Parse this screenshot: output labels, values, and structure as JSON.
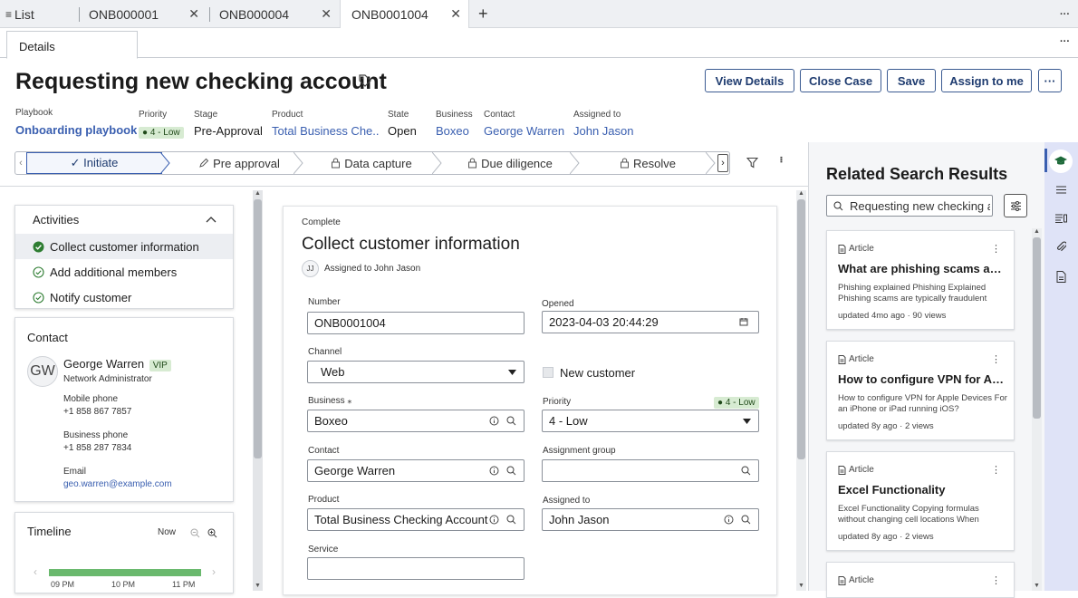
{
  "tabs": {
    "list": "List",
    "t1": "ONB000001",
    "t2": "ONB000004",
    "t3": "ONB0001004",
    "add": "+",
    "more": "···"
  },
  "subtabs": {
    "details": "Details",
    "more": "···"
  },
  "header": {
    "title": "Requesting new checking account",
    "buttons": {
      "view": "View Details",
      "close": "Close Case",
      "save": "Save",
      "assign": "Assign to me",
      "more": "···"
    }
  },
  "meta": {
    "playbook_l": "Playbook",
    "playbook_v": "Onboarding playbook",
    "priority_l": "Priority",
    "priority_v": "● 4 - Low",
    "stage_l": "Stage",
    "stage_v": "Pre-Approval",
    "product_l": "Product",
    "product_v": "Total Business Che...",
    "state_l": "State",
    "state_v": "Open",
    "business_l": "Business",
    "business_v": "Boxeo",
    "contact_l": "Contact",
    "contact_v": "George Warren",
    "assigned_l": "Assigned to",
    "assigned_v": "John Jason"
  },
  "stages": [
    "✓ Initiate",
    "Pre approval",
    "Data capture",
    "Due diligence",
    "Resolve"
  ],
  "activities": {
    "title": "Activities",
    "items": [
      "Collect customer information",
      "Add additional members",
      "Notify customer"
    ]
  },
  "contact": {
    "title": "Contact",
    "initials": "GW",
    "name": "George Warren",
    "vip": "VIP",
    "role": "Network Administrator",
    "mobile_l": "Mobile phone",
    "mobile_v": "+1 858 867 7857",
    "business_l": "Business phone",
    "business_v": "+1 858 287 7834",
    "email_l": "Email",
    "email_v": "geo.warren@example.com"
  },
  "timeline": {
    "title": "Timeline",
    "now": "Now",
    "ticks": [
      "09 PM",
      "10 PM",
      "11 PM"
    ],
    "prev": "‹",
    "next": "›"
  },
  "form": {
    "status": "Complete",
    "title": "Collect customer information",
    "avatar": "JJ",
    "assigned": "Assigned to John Jason",
    "number_l": "Number",
    "number_v": "ONB0001004",
    "opened_l": "Opened",
    "opened_v": "2023-04-03 20:44:29",
    "channel_l": "Channel",
    "channel_v": "Web",
    "newcust": "New customer",
    "business_l": "Business ⁎",
    "business_v": "Boxeo",
    "priority_l": "Priority",
    "priority_badge": "● 4 - Low",
    "priority_v": "4 - Low",
    "contact_l": "Contact",
    "contact_v": "George Warren",
    "group_l": "Assignment group",
    "group_v": "",
    "product_l": "Product",
    "product_v": "Total Business Checking  Account",
    "assigned_l": "Assigned to",
    "assigned_v": "John Jason",
    "service_l": "Service",
    "service_v": ""
  },
  "related": {
    "title": "Related Search Results",
    "search_value": "Requesting new checking a",
    "cards": [
      {
        "tag": "Article",
        "title": "What are phishing scams and ...",
        "desc": "Phishing explained Phishing Explained Phishing scams are typically fraudulent",
        "meta": "updated 4mo ago · 90 views"
      },
      {
        "tag": "Article",
        "title": "How to configure VPN for Ap...",
        "desc": "How to configure VPN for Apple Devices For an iPhone or iPad running iOS?",
        "meta": "updated 8y ago · 2 views"
      },
      {
        "tag": "Article",
        "title": "Excel Functionality",
        "desc": "Excel Functionality Copying formulas without changing cell locations When",
        "meta": "updated 8y ago · 2 views"
      },
      {
        "tag": "Article"
      }
    ]
  },
  "colors": {
    "accent": "#3a5fb0",
    "green": "#2e7d32",
    "rail": "#dfe3f7"
  }
}
